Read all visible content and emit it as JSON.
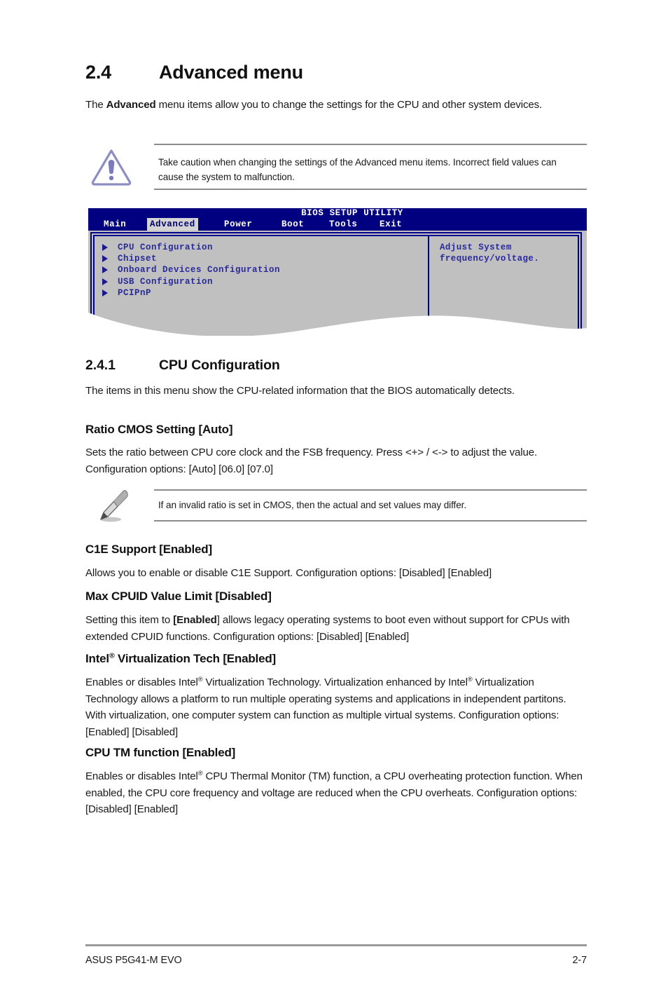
{
  "document": {
    "section_2_4": {
      "number": "2.4",
      "title": "Advanced menu",
      "intro_before_bold": "The ",
      "intro_bold": "Advanced",
      "intro_after_bold": " menu items allow you to change the settings for the CPU and other system devices."
    },
    "warning_callout": {
      "icon": "warning-triangle-icon",
      "text": "Take caution when changing the settings of the Advanced menu items. Incorrect field values can cause the system to malfunction."
    },
    "bios_screenshot": {
      "utility_title": "BIOS SETUP UTILITY",
      "tabs": [
        {
          "label": "Main",
          "active": false
        },
        {
          "label": "Advanced",
          "active": true
        },
        {
          "label": "Power",
          "active": false
        },
        {
          "label": "Boot",
          "active": false
        },
        {
          "label": "Tools",
          "active": false
        },
        {
          "label": "Exit",
          "active": false
        }
      ],
      "menu_items": [
        "CPU Configuration",
        "Chipset",
        "Onboard Devices Configuration",
        "USB Configuration",
        "PCIPnP"
      ],
      "help_text": "Adjust System\nfrequency/voltage.",
      "colors": {
        "titlebar": "#000080",
        "body": "#c0c0c0",
        "border": "#00008f",
        "text": "#2a2a9e",
        "active_tab_bg": "#d4d4d4",
        "active_tab_text": "#00006a"
      }
    },
    "section_2_4_1": {
      "number": "2.4.1",
      "title": "CPU Configuration",
      "intro": "The items in this menu show the CPU-related information that the BIOS automatically detects."
    },
    "items": [
      {
        "heading": "Ratio CMOS Setting [Auto]",
        "body": "Sets the ratio between CPU core clock and the FSB frequency. Press <+> / <-> to adjust the value. Configuration options: [Auto] [06.0] [07.0]"
      },
      {
        "heading": "C1E Support [Enabled]",
        "body": "Allows you to enable or disable C1E Support. Configuration options: [Disabled] [Enabled]"
      },
      {
        "heading": "Max CPUID Value Limit [Disabled]",
        "body_part1": "Setting this item to ",
        "body_bold": "[Enabled",
        "body_part2": "] allows legacy operating systems to boot even without support for CPUs with extended CPUID functions. Configuration options: [Disabled] [Enabled]"
      },
      {
        "heading_part1": "Intel",
        "heading_sup": "®",
        "heading_part2": " Virtualization Tech [Enabled]",
        "body_p1": "Enables or disables Intel",
        "body_sup1": "®",
        "body_p2": " Virtualization Technology. Virtualization enhanced by Intel",
        "body_sup2": "®",
        "body_p3": " Virtualization Technology allows a platform to run multiple operating systems and applications in independent partitons. With virtualization, one computer system can function as multiple virtual systems. Configuration options: [Enabled] [Disabled]"
      },
      {
        "heading": "CPU TM function [Enabled]",
        "body_p1": "Enables or disables Intel",
        "body_sup1": "®",
        "body_p2": " CPU Thermal Monitor (TM) function, a CPU overheating protection function. When enabled, the CPU core frequency and voltage are reduced when the CPU overheats. Configuration options: [Disabled] [Enabled]"
      }
    ],
    "note_callout": {
      "icon": "pencil-note-icon",
      "text": "If an invalid ratio is set in CMOS, then the actual and set values may differ."
    },
    "footer": {
      "left": "ASUS P5G41-M EVO",
      "right": "2-7"
    }
  }
}
